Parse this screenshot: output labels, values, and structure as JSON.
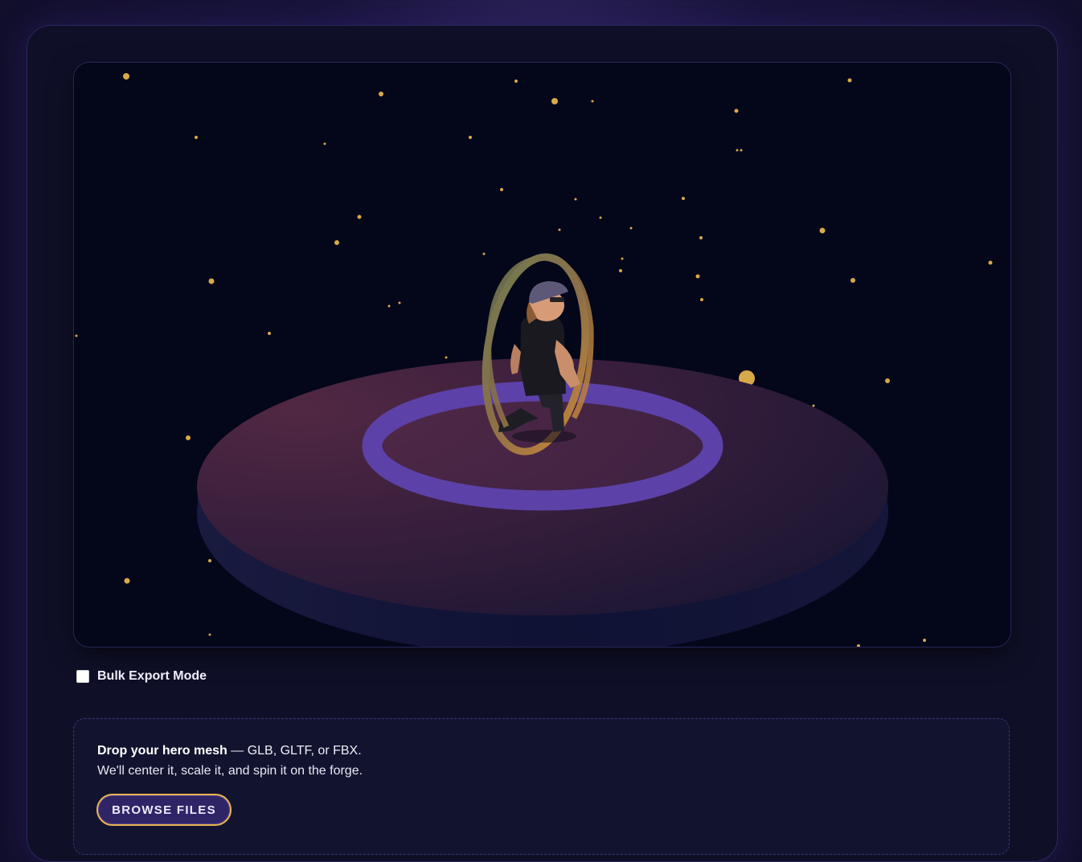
{
  "bulk_export": {
    "label": "Bulk Export Mode",
    "checked": false
  },
  "dropzone": {
    "title_bold": "Drop your hero mesh",
    "title_rest": " — GLB, GLTF, or FBX.",
    "subtitle": "We'll center it, scale it, and spin it on the forge.",
    "browse_label": "BROWSE FILES"
  },
  "colors": {
    "page_bg": "#141130",
    "panel_bg": "#0f1028",
    "viewport_bg": "#04061a",
    "star": "#d8a94a",
    "ring": "#5c41a8",
    "accent_border": "#e8b552"
  },
  "icons": {
    "checkbox": "checkbox-icon",
    "star": "star-icon"
  }
}
